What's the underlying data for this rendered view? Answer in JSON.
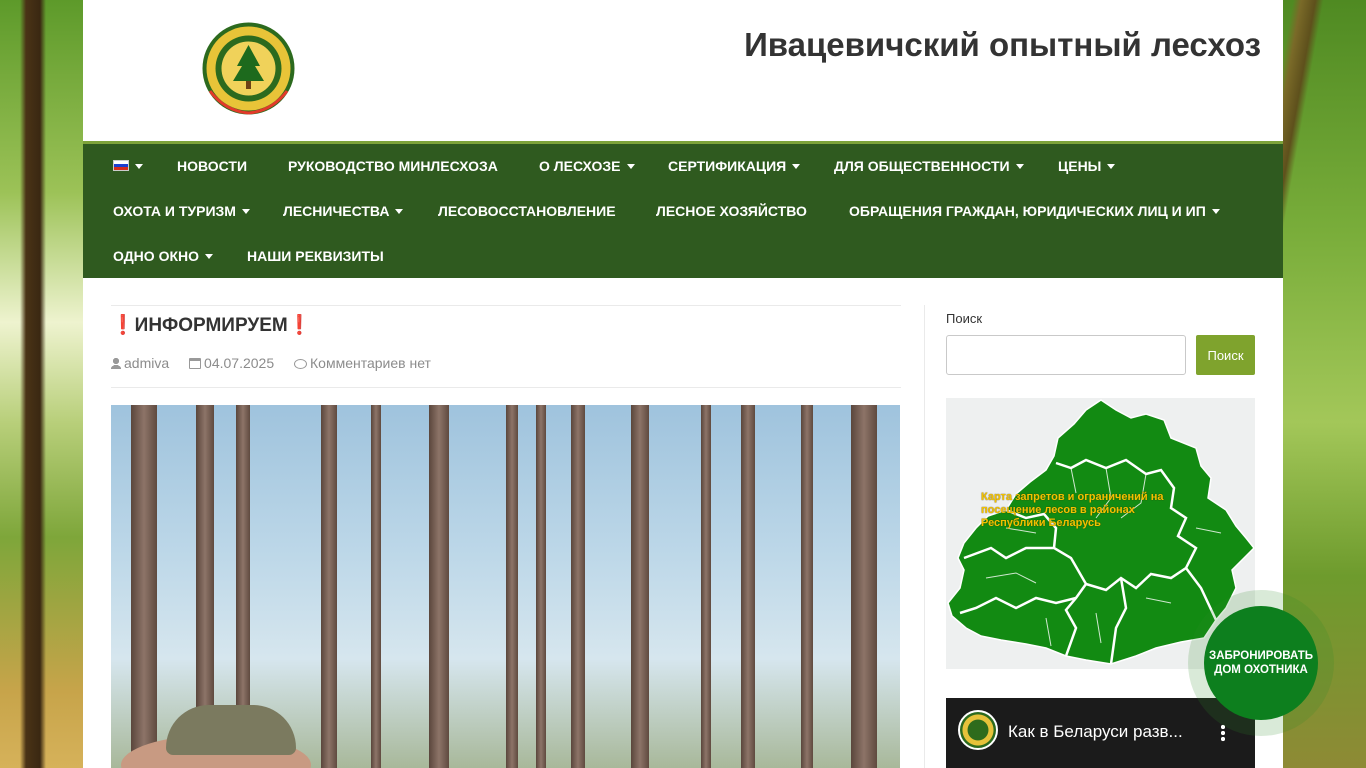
{
  "site": {
    "title": "Ивацевичский опытный лесхоз",
    "logo_icon": "forestry-emblem-logo"
  },
  "nav": {
    "language_flag": "russian-flag-icon",
    "items_row1": [
      {
        "label": "НОВОСТИ",
        "dropdown": false
      },
      {
        "label": "РУКОВОДСТВО МИНЛЕСХОЗА",
        "dropdown": false
      },
      {
        "label": "О ЛЕСХОЗЕ",
        "dropdown": true
      },
      {
        "label": "СЕРТИФИКАЦИЯ",
        "dropdown": true
      },
      {
        "label": "ДЛЯ ОБЩЕСТВЕННОСТИ",
        "dropdown": true
      },
      {
        "label": "ЦЕНЫ",
        "dropdown": true
      }
    ],
    "items_row2": [
      {
        "label": "ОХОТА И ТУРИЗМ",
        "dropdown": true
      },
      {
        "label": "ЛЕСНИЧЕСТВА",
        "dropdown": true
      },
      {
        "label": "ЛЕСОВОССТАНОВЛЕНИЕ",
        "dropdown": false
      },
      {
        "label": "ЛЕСНОЕ ХОЗЯЙСТВО",
        "dropdown": false
      },
      {
        "label": "ОБРАЩЕНИЯ ГРАЖДАН, ЮРИДИЧЕСКИХ ЛИЦ И ИП",
        "dropdown": true
      }
    ],
    "items_row3": [
      {
        "label": "ОДНО ОКНО",
        "dropdown": true
      },
      {
        "label": "НАШИ РЕКВИЗИТЫ",
        "dropdown": false
      }
    ]
  },
  "post": {
    "title": "ИНФОРМИРУЕМ",
    "title_marker": "❗",
    "author": "admiva",
    "date": "04.07.2025",
    "comments": "Комментариев нет"
  },
  "sidebar": {
    "search_label": "Поиск",
    "search_value": "",
    "search_button": "Поиск",
    "map_caption": "Карта запретов и ограничений на посещение лесов в районах Республики Беларусь",
    "video_title": "Как в Беларуси разв..."
  },
  "floating_button": {
    "label_line1": "ЗАБРОНИРОВАТЬ",
    "label_line2": "ДОМ ОХОТНИКА"
  },
  "colors": {
    "nav_bg": "#2f5a1f",
    "accent": "#7fa32d",
    "alert": "#d0112b",
    "map_green": "#128a12"
  }
}
